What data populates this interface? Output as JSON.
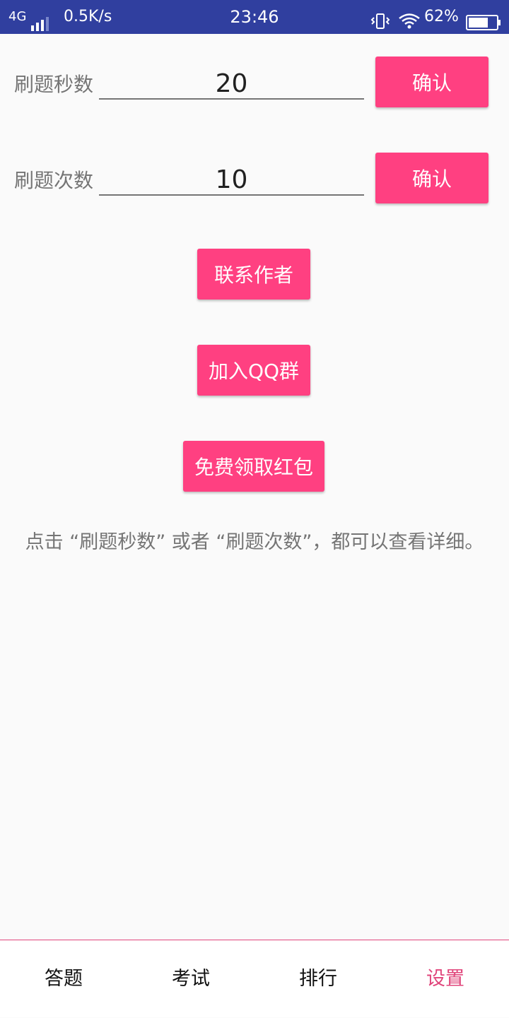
{
  "status_bar": {
    "network": "4G",
    "speed": "0.5K/s",
    "time": "23:46",
    "battery_pct": "62%",
    "icons": [
      "signal-icon",
      "vibrate-icon",
      "wifi-icon",
      "battery-icon"
    ]
  },
  "settings": {
    "seconds_label": "刷题秒数",
    "seconds_value": "20",
    "seconds_confirm": "确认",
    "count_label": "刷题次数",
    "count_value": "10",
    "count_confirm": "确认"
  },
  "actions": {
    "contact_author": "联系作者",
    "join_qq_group": "加入QQ群",
    "free_red_packet": "免费领取红包"
  },
  "hint": "点击 “刷题秒数” 或者 “刷题次数”，都可以查看详细。",
  "bottom_nav": {
    "items": [
      {
        "label": "答题"
      },
      {
        "label": "考试"
      },
      {
        "label": "排行"
      },
      {
        "label": "设置"
      }
    ],
    "active_index": 3
  },
  "colors": {
    "status_bar": "#303f9f",
    "accent": "#ff4081",
    "nav_active": "#e0457b",
    "background": "#fafafa"
  }
}
